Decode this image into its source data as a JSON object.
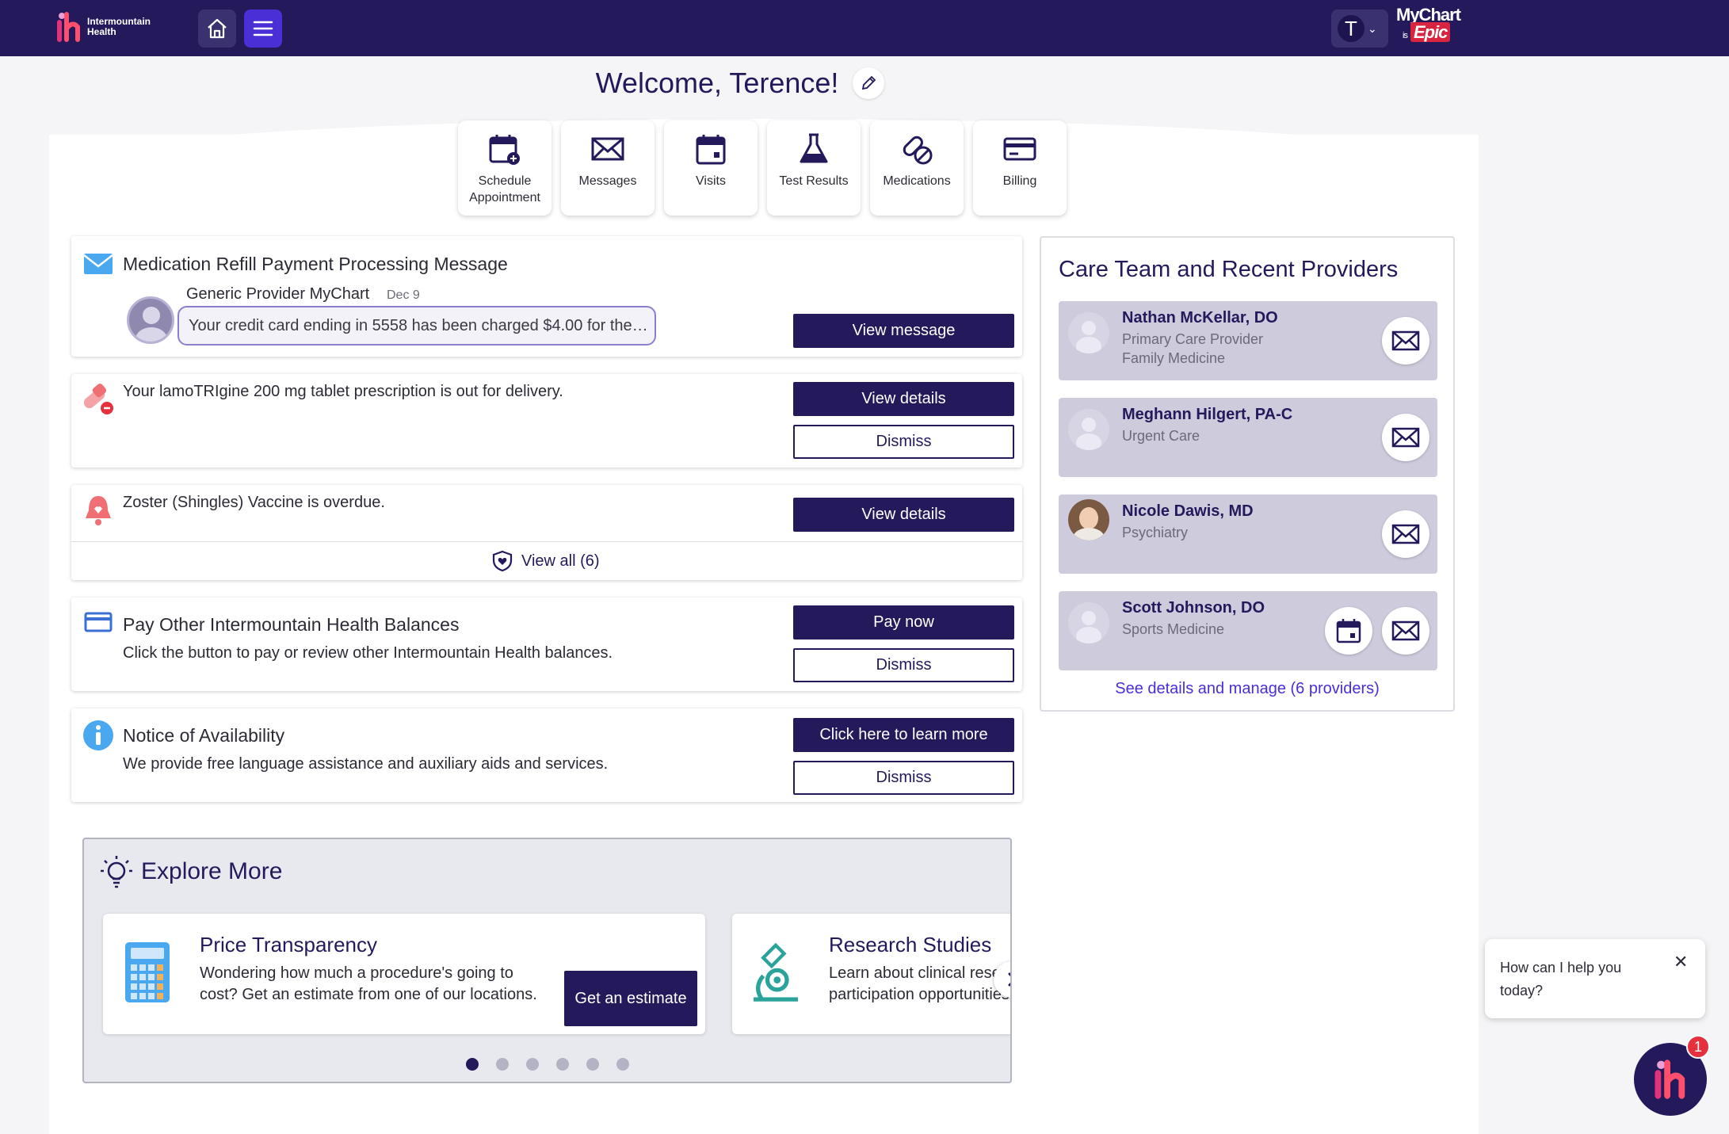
{
  "brand": {
    "name_line1": "Intermountain",
    "name_line2": "Health",
    "mychart": "MyChart",
    "mychart_is": "is",
    "mychart_epic": "Epic"
  },
  "account": {
    "initial": "T"
  },
  "welcome": {
    "text": "Welcome, Terence!"
  },
  "quicklinks": [
    {
      "label": "Schedule Appointment",
      "icon": "calendar-plus-icon"
    },
    {
      "label": "Messages",
      "icon": "envelope-icon"
    },
    {
      "label": "Visits",
      "icon": "calendar-icon"
    },
    {
      "label": "Test Results",
      "icon": "flask-icon"
    },
    {
      "label": "Medications",
      "icon": "pills-icon"
    },
    {
      "label": "Billing",
      "icon": "credit-card-icon"
    }
  ],
  "cards": {
    "message": {
      "title": "Medication Refill Payment Processing Message",
      "sender": "Generic Provider MyChart",
      "date": "Dec 9",
      "preview": "Your credit card ending in 5558 has been charged $4.00 for the…",
      "button": "View message"
    },
    "prescription": {
      "text": "Your lamoTRIgine 200 mg tablet prescription is out for delivery.",
      "primary": "View details",
      "secondary": "Dismiss"
    },
    "vaccine": {
      "text": "Zoster (Shingles) Vaccine is overdue.",
      "primary": "View details",
      "view_all": "View all (6)"
    },
    "balances": {
      "title": "Pay Other Intermountain Health Balances",
      "text": "Click the button to pay or review other Intermountain Health balances.",
      "primary": "Pay now",
      "secondary": "Dismiss"
    },
    "availability": {
      "title": "Notice of Availability",
      "text": "We provide free language assistance and auxiliary aids and services.",
      "primary": "Click here to learn more",
      "secondary": "Dismiss"
    }
  },
  "care_team": {
    "title": "Care Team and Recent Providers",
    "providers": [
      {
        "name": "Nathan McKellar, DO",
        "role1": "Primary Care Provider",
        "role2": "Family Medicine"
      },
      {
        "name": "Meghann Hilgert, PA-C",
        "role1": "Urgent Care",
        "role2": ""
      },
      {
        "name": "Nicole Dawis, MD",
        "role1": "Psychiatry",
        "role2": ""
      },
      {
        "name": "Scott Johnson, DO",
        "role1": "Sports Medicine",
        "role2": ""
      }
    ],
    "link": "See details and manage (6 providers)"
  },
  "explore": {
    "title": "Explore More",
    "cards": [
      {
        "title": "Price Transparency",
        "desc": "Wondering how much a procedure's going to cost? Get an estimate from one of our locations.",
        "button": "Get an estimate",
        "icon": "calculator-icon"
      },
      {
        "title": "Research Studies",
        "desc": "Learn about clinical research participation opportunities",
        "icon": "microscope-icon"
      }
    ],
    "active_slide": 1,
    "slide_count": 6
  },
  "chat": {
    "prompt": "How can I help you today?",
    "badge": "1"
  },
  "colors": {
    "primary": "#24195b",
    "accent": "#4a2ed6",
    "alert": "#e5303d"
  }
}
